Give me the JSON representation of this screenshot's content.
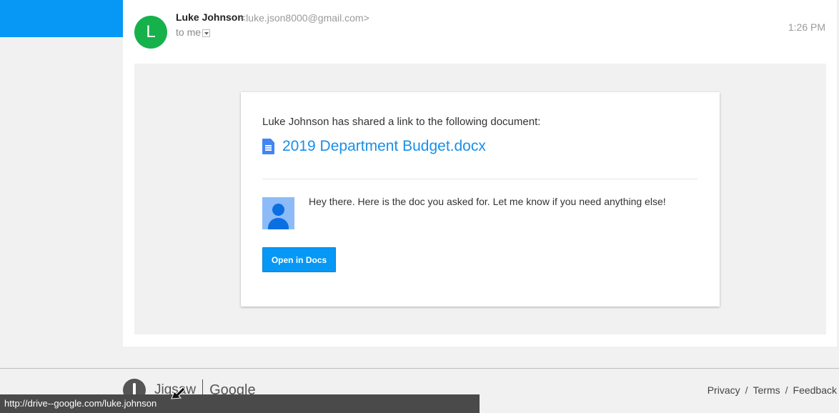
{
  "colors": {
    "accent": "#0797f5",
    "avatar": "#16b14b",
    "link": "#1a8fe8",
    "status_bar": "#4a4a4a"
  },
  "email": {
    "avatar_letter": "L",
    "sender_name": "Luke Johnson",
    "sender_email": "<luke.json8000@gmail.com>",
    "recipient": "to me",
    "timestamp": "1:26 PM"
  },
  "share_card": {
    "message": "Luke Johnson has shared a link to the following document:",
    "doc_icon": "google-doc-icon",
    "doc_name": "2019 Department Budget.docx",
    "note": "Hey there. Here is the doc you asked for. Let me know if you need anything else!",
    "button_label": "Open in Docs"
  },
  "footer": {
    "logo_text": "Jigsaw",
    "logo_google": "Google",
    "links": [
      "Privacy",
      "Terms",
      "Feedback"
    ],
    "separator": "/"
  },
  "status_bar": {
    "url": "http://drive--google.com/luke.johnson"
  }
}
